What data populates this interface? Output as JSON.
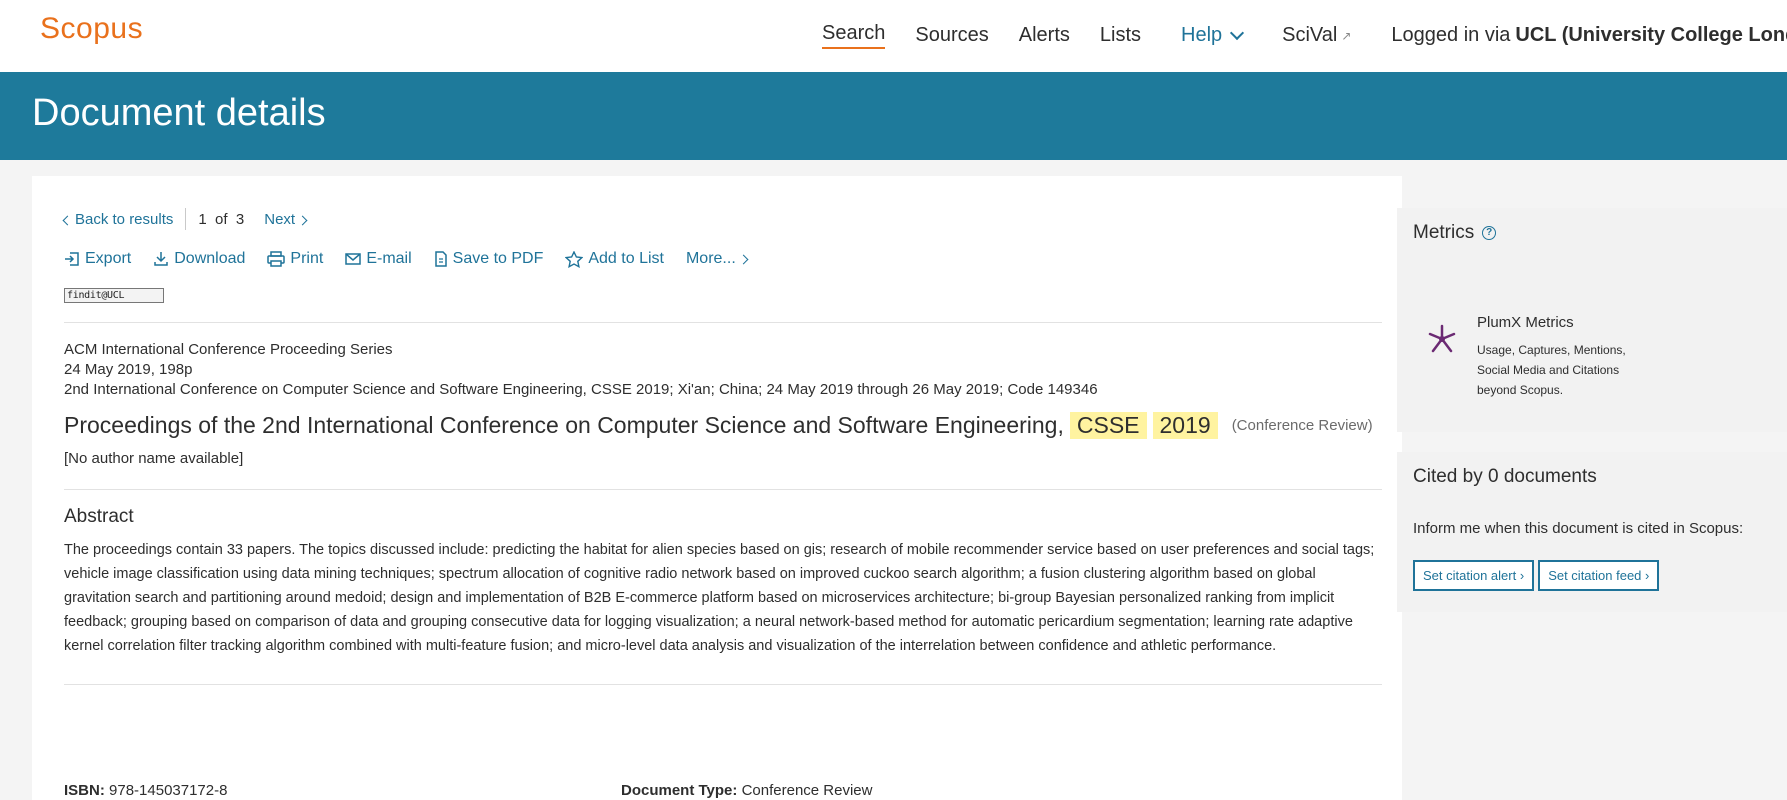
{
  "header": {
    "logo": "Scopus",
    "nav": {
      "search": "Search",
      "sources": "Sources",
      "alerts": "Alerts",
      "lists": "Lists",
      "help": "Help",
      "scival": "SciVal",
      "logged_prefix": "Logged in via",
      "institution": "UCL (University College London"
    }
  },
  "banner": {
    "title": "Document details"
  },
  "result_nav": {
    "back": "Back to results",
    "position": "1  of  3",
    "next": "Next"
  },
  "actions": {
    "export": "Export",
    "download": "Download",
    "print": "Print",
    "email": "E-mail",
    "save_pdf": "Save to PDF",
    "add_list": "Add to List",
    "more": "More..."
  },
  "findit_logo": "findit@UCL",
  "source": {
    "series": "ACM International Conference Proceeding Series",
    "date_pages": "24 May 2019, 198p",
    "conference": "2nd International Conference on Computer Science and Software Engineering, CSSE 2019; Xi'an; China; 24 May 2019 through 26 May 2019; Code 149346"
  },
  "document": {
    "title_main": "Proceedings of the 2nd International Conference on Computer Science and Software Engineering,",
    "highlight1": "CSSE",
    "highlight2": "2019",
    "doc_type_label": "(Conference Review)",
    "authors": "[No author name available]"
  },
  "abstract": {
    "heading": "Abstract",
    "text": "The proceedings contain 33 papers. The topics discussed include: predicting the habitat for alien species based on gis; research of mobile recommender service based on user preferences and social tags; vehicle image classification using data mining techniques; spectrum allocation of cognitive radio network based on improved cuckoo search algorithm; a fusion clustering algorithm based on global gravitation search and partitioning around medoid; design and implementation of B2B E-commerce platform based on microservices architecture; bi-group Bayesian personalized ranking from implicit feedback; grouping based on comparison of data and grouping consecutive data for logging visualization; a neural network-based method for automatic pericardium segmentation; learning rate adaptive kernel correlation filter tracking algorithm combined with multi-feature fusion; and micro-level data analysis and visualization of the interrelation between confidence and athletic performance."
  },
  "meta": {
    "isbn_label": "ISBN:",
    "isbn_value": "978-145037172-8",
    "doctype_label": "Document Type:",
    "doctype_value": "Conference Review"
  },
  "metrics": {
    "heading": "Metrics",
    "help_glyph": "?",
    "plumx_title": "PlumX Metrics",
    "plumx_desc": "Usage, Captures, Mentions, Social Media and Citations beyond Scopus."
  },
  "cited": {
    "heading": "Cited by 0 documents",
    "inform": "Inform me when this document is cited in Scopus:",
    "alert_btn": "Set citation alert",
    "feed_btn": "Set citation feed"
  },
  "colors": {
    "brand_orange": "#e9711c",
    "banner_teal": "#1e7a9b",
    "link_blue": "#1f7399",
    "highlight": "#fff3a0",
    "plumx_purple": "#6b2a73"
  }
}
